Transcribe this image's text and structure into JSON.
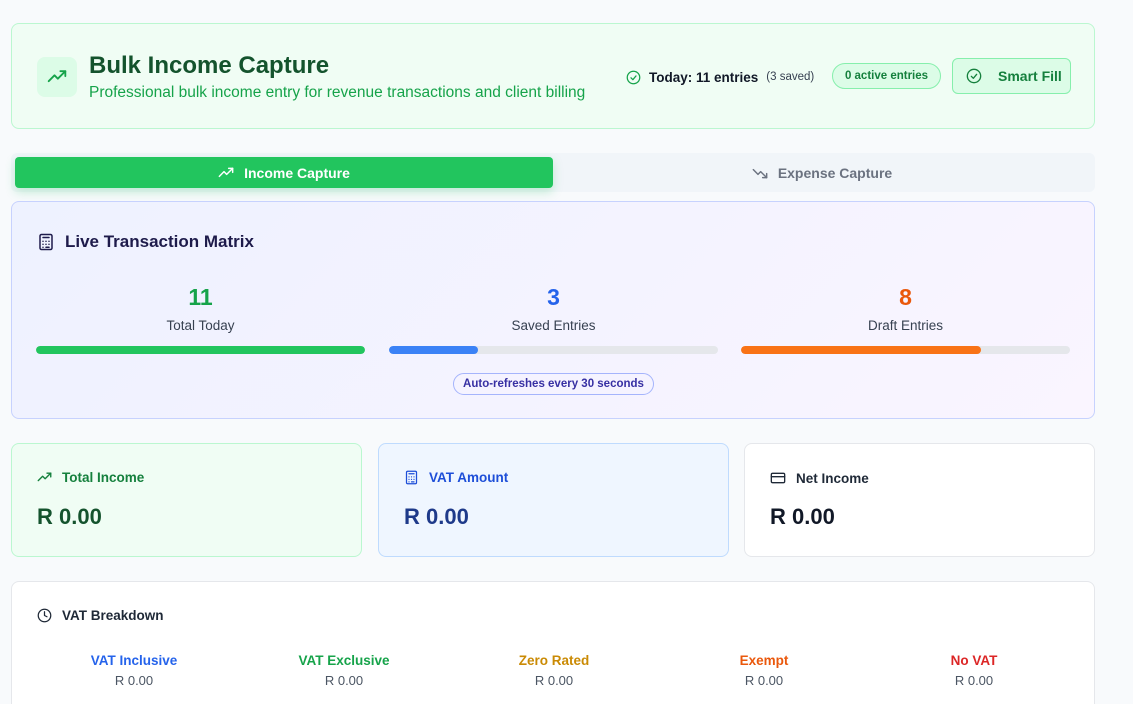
{
  "header": {
    "icon": "trending-up-icon",
    "title": "Bulk Income Capture",
    "subtitle": "Professional bulk income entry for revenue transactions and client billing",
    "today_icon": "check-circle-icon",
    "today_label": "Today: 11 entries",
    "today_saved": "(3 saved)",
    "active_entries": "0 active entries",
    "smart_fill_icon": "check-circle-icon",
    "smart_fill_label": "Smart Fill"
  },
  "tabs": [
    {
      "label": "Income Capture",
      "icon": "trending-up-icon",
      "active": true
    },
    {
      "label": "Expense Capture",
      "icon": "trending-down-icon",
      "active": false
    }
  ],
  "matrix": {
    "icon": "calculator-icon",
    "title": "Live Transaction Matrix",
    "stats": [
      {
        "value": "11",
        "label": "Total Today",
        "progress": 1.0,
        "color": "#22c55e",
        "text_color": "#16a34a"
      },
      {
        "value": "3",
        "label": "Saved Entries",
        "progress": 0.27,
        "color": "#3b82f6",
        "text_color": "#2563eb"
      },
      {
        "value": "8",
        "label": "Draft Entries",
        "progress": 0.73,
        "color": "#f97316",
        "text_color": "#ea580c"
      }
    ],
    "refresh_note": "Auto-refreshes every 30 seconds"
  },
  "summary": {
    "income": {
      "label": "Total Income",
      "value": "R 0.00",
      "icon": "trending-up-icon"
    },
    "vat": {
      "label": "VAT Amount",
      "value": "R 0.00",
      "icon": "calculator-icon"
    },
    "net": {
      "label": "Net Income",
      "value": "R 0.00",
      "icon": "credit-card-icon"
    }
  },
  "breakdown": {
    "icon": "clock-icon",
    "title": "VAT Breakdown",
    "items": [
      {
        "label": "VAT Inclusive",
        "value": "R 0.00",
        "color": "#2563eb"
      },
      {
        "label": "VAT Exclusive",
        "value": "R 0.00",
        "color": "#16a34a"
      },
      {
        "label": "Zero Rated",
        "value": "R 0.00",
        "color": "#ca8a04"
      },
      {
        "label": "Exempt",
        "value": "R 0.00",
        "color": "#ea580c"
      },
      {
        "label": "No VAT",
        "value": "R 0.00",
        "color": "#dc2626"
      }
    ]
  }
}
